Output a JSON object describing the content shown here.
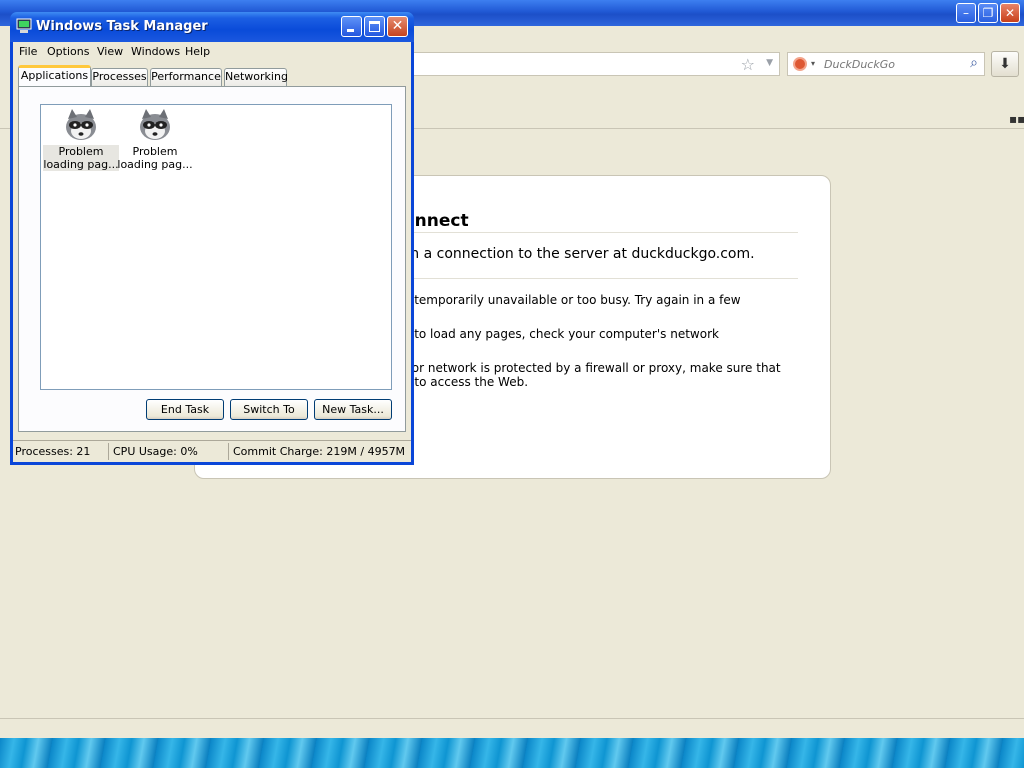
{
  "browser": {
    "search_placeholder": "DuckDuckGo",
    "error": {
      "title": "onnect",
      "short_desc": "sh a connection to the server at duckduckgo.com.",
      "items": [
        "e temporarily unavailable or too busy. Try again in a few",
        "e to load any pages, check your computer's network",
        "r or network is protected by a firewall or proxy, make sure that",
        "d to access the Web."
      ]
    }
  },
  "taskmgr": {
    "title": "Windows Task Manager",
    "menu": [
      "File",
      "Options",
      "View",
      "Windows",
      "Help"
    ],
    "tabs": [
      "Applications",
      "Processes",
      "Performance",
      "Networking"
    ],
    "active_tab": "Applications",
    "apps": [
      {
        "line1": "Problem",
        "line2": "loading pag...",
        "selected": true
      },
      {
        "line1": "Problem",
        "line2": "loading pag...",
        "selected": false
      }
    ],
    "buttons": {
      "end_task": "End Task",
      "switch_to": "Switch To",
      "new_task": "New Task..."
    },
    "status": {
      "processes": "Processes: 21",
      "cpu": "CPU Usage: 0%",
      "commit": "Commit Charge: 219M / 4957M"
    }
  },
  "colors": {
    "xp_title_blue": "#0a46d8",
    "window_face": "#ece9d8",
    "tab_highlight": "#ffc83c"
  }
}
